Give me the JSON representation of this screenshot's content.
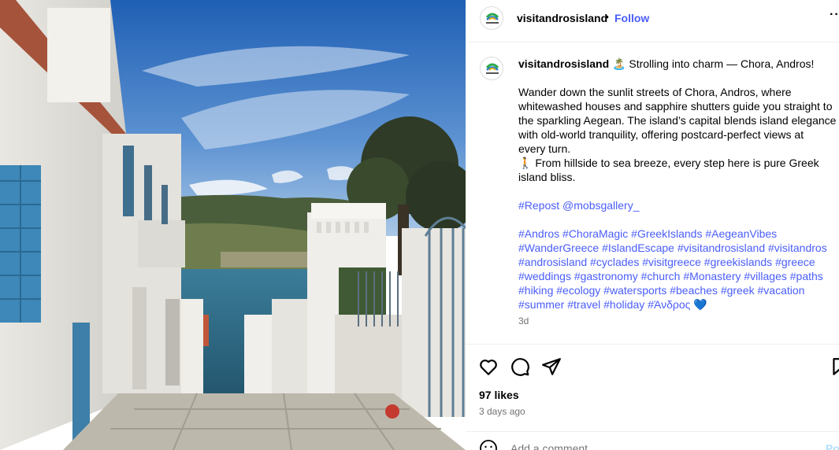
{
  "post": {
    "username": "visitandrosisland",
    "follow_label": "Follow",
    "header_separator": "•",
    "avatar_logo_text": "visit andros",
    "more_label": "···"
  },
  "caption": {
    "username": "visitandrosisland",
    "title_emoji": "🏝️",
    "title": "Strolling into charm — Chora, Andros!",
    "body_lines": [
      "Wander down the sunlit streets of Chora, Andros, where",
      "whitewashed houses and sapphire shutters guide you straight to",
      "the sparkling Aegean. The island’s capital blends island elegance",
      "with old-world tranquility, offering postcard-perfect views at",
      "every turn."
    ],
    "line2_emoji": "🚶",
    "line2_a": "From hillside to sea breeze, every step here is pure Greek",
    "line2_b": "island bliss.",
    "repost": "#Repost @mobsgallery_",
    "hashtag_lines": [
      "#Andros #ChoraMagic #GreekIslands #AegeanVibes",
      "#WanderGreece #IslandEscape #visitandrosisland #visitandros",
      "#androsisland #cyclades #visitgreece #greekislands #greece",
      "#weddings #gastronomy #church #Monastery #villages #paths",
      "#hiking #ecology #watersports #beaches #greek #vacation",
      "#summer #travel #holiday #Άνδρος"
    ],
    "heart_emoji": "💙",
    "age": "3d"
  },
  "actions": {
    "likes": "97 likes",
    "posted": "3 days ago",
    "comment_placeholder": "Add a comment...",
    "post_label": "Post"
  },
  "icons": {
    "like": "heart-icon",
    "comment": "comment-bubble-icon",
    "share": "paper-plane-icon",
    "save": "bookmark-icon",
    "emoji": "smiley-icon"
  },
  "colors": {
    "link_blue": "#4a5df9",
    "secondary_gray": "#737373",
    "post_disabled": "#b2dffc",
    "shutter_blue": "#3d88b8",
    "sea_blue": "#2e6f8c",
    "sky_blue": "#2f71c2"
  }
}
